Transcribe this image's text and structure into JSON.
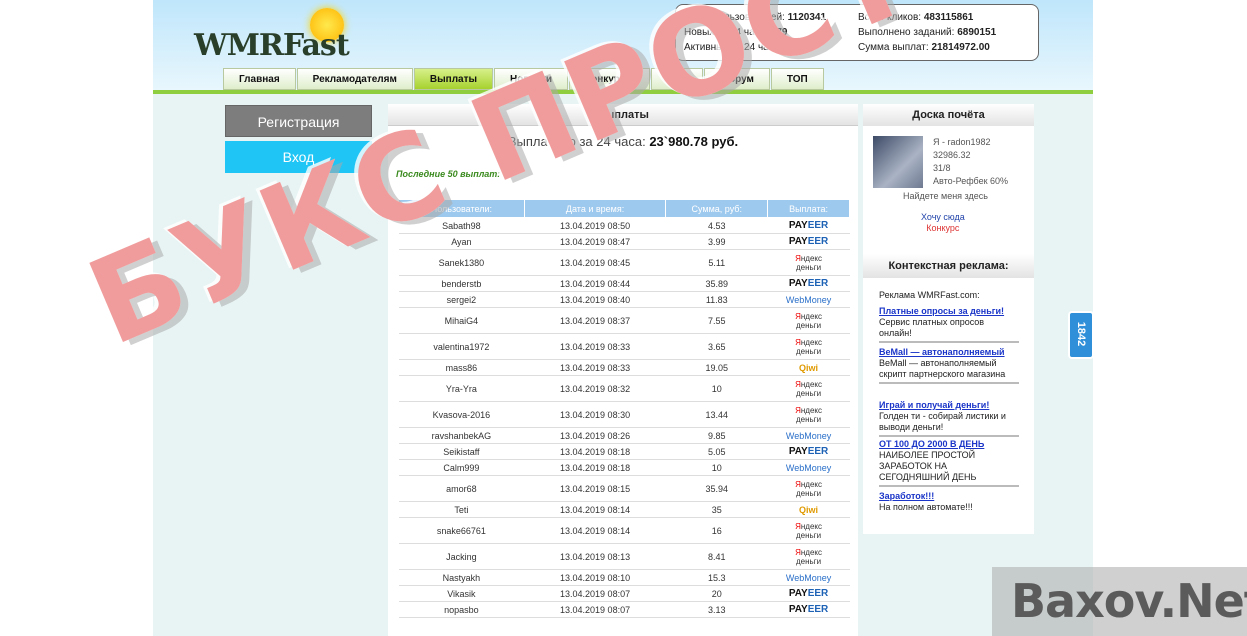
{
  "logo": {
    "text": "WMRFast"
  },
  "stats": {
    "total_users_label": "Всего пользователей:",
    "total_users": "1120341",
    "new24_label": "Новых за 24 часа:",
    "new24": "679",
    "active24_label": "Активных за 24 часа:",
    "active24": "21130",
    "total_clicks_label": "Всего кликов:",
    "total_clicks": "483115861",
    "tasks_label": "Выполнено заданий:",
    "tasks": "6890151",
    "paid_label": "Сумма выплат:",
    "paid": "21814972.00"
  },
  "nav": [
    "Главная",
    "Рекламодателям",
    "Выплаты",
    "Новости",
    "Конкурсы",
    "FAQ",
    "Форум",
    "ТОП"
  ],
  "auth": {
    "register": "Регистрация",
    "login": "Вход"
  },
  "main": {
    "title": "Выплаты",
    "paid24_label": "Выплачено за 24 часа:",
    "paid24_value": "23`980.78 руб.",
    "last50": "Последние 50 выплат:",
    "columns": [
      "Пользователи:",
      "Дата и время:",
      "Сумма, руб:",
      "Выплата:"
    ],
    "rows": [
      {
        "user": "Sabath98",
        "date": "13.04.2019 08:50",
        "sum": "4.53",
        "pm": "payeer"
      },
      {
        "user": "Ayan",
        "date": "13.04.2019 08:47",
        "sum": "3.99",
        "pm": "payeer"
      },
      {
        "user": "Sanek1380",
        "date": "13.04.2019 08:45",
        "sum": "5.11",
        "pm": "yandex"
      },
      {
        "user": "benderstb",
        "date": "13.04.2019 08:44",
        "sum": "35.89",
        "pm": "payeer"
      },
      {
        "user": "sergei2",
        "date": "13.04.2019 08:40",
        "sum": "11.83",
        "pm": "webmoney"
      },
      {
        "user": "MihaiG4",
        "date": "13.04.2019 08:37",
        "sum": "7.55",
        "pm": "yandex"
      },
      {
        "user": "valentina1972",
        "date": "13.04.2019 08:33",
        "sum": "3.65",
        "pm": "yandex"
      },
      {
        "user": "mass86",
        "date": "13.04.2019 08:33",
        "sum": "19.05",
        "pm": "qiwi"
      },
      {
        "user": "Yra-Yra",
        "date": "13.04.2019 08:32",
        "sum": "10",
        "pm": "yandex"
      },
      {
        "user": "Kvasova-2016",
        "date": "13.04.2019 08:30",
        "sum": "13.44",
        "pm": "yandex"
      },
      {
        "user": "ravshanbekAG",
        "date": "13.04.2019 08:26",
        "sum": "9.85",
        "pm": "webmoney"
      },
      {
        "user": "Seikistaff",
        "date": "13.04.2019 08:18",
        "sum": "5.05",
        "pm": "payeer"
      },
      {
        "user": "Calm999",
        "date": "13.04.2019 08:18",
        "sum": "10",
        "pm": "webmoney"
      },
      {
        "user": "amor68",
        "date": "13.04.2019 08:15",
        "sum": "35.94",
        "pm": "yandex"
      },
      {
        "user": "Teti",
        "date": "13.04.2019 08:14",
        "sum": "35",
        "pm": "qiwi"
      },
      {
        "user": "snake66761",
        "date": "13.04.2019 08:14",
        "sum": "16",
        "pm": "yandex"
      },
      {
        "user": "Jacking",
        "date": "13.04.2019 08:13",
        "sum": "8.41",
        "pm": "yandex"
      },
      {
        "user": "Nastyakh",
        "date": "13.04.2019 08:10",
        "sum": "15.3",
        "pm": "webmoney"
      },
      {
        "user": "Vikasik",
        "date": "13.04.2019 08:07",
        "sum": "20",
        "pm": "payeer"
      },
      {
        "user": "nopasbo",
        "date": "13.04.2019 08:07",
        "sum": "3.13",
        "pm": "payeer"
      }
    ]
  },
  "payment_labels": {
    "payeer_a": "PAY",
    "payeer_b": "EER",
    "webmoney": "WebMoney",
    "yandex_a": "Я",
    "yandex_b": "ндекс",
    "yandex_c": "деньги",
    "qiwi": "Qiwi"
  },
  "honor": {
    "title": "Доска почёта",
    "user": "Я - radon1982",
    "points": "32986.32",
    "level": "31/8",
    "refback": "Авто-Рефбек 60%",
    "find": "Найдете меня здесь",
    "want1": "Хочу сюда",
    "want2": "Конкурс"
  },
  "context": {
    "title": "Контекстная реклама:",
    "intro": "Реклама WMRFast.com:",
    "ads": [
      {
        "title": "Платные опросы за деньги!",
        "text": "Сервис платных опросов онлайн!"
      },
      {
        "title": "BeMall — автонаполняемый",
        "text": "BeMall — автонаполняемый скрипт партнерского магазина"
      },
      {
        "title": "Играй и получай деньги!",
        "text": "Голден ти - собирай листики и выводи деньги!"
      },
      {
        "title": "ОТ 100 ДО 2000 В ДЕНЬ",
        "text": "НАИБОЛЕЕ ПРОСТОЙ ЗАРАБОТОК НА СЕГОДНЯШНИЙ ДЕНЬ"
      },
      {
        "title": "Заработок!!!",
        "text": "На полном автомате!!!"
      }
    ]
  },
  "side_tab": "1842",
  "watermarks": {
    "main": "БУКС ПРОСТОБУКС",
    "corner": "Baxov.Net"
  }
}
